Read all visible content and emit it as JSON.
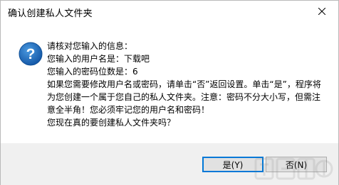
{
  "dialog": {
    "title": "确认创建私人文件夹",
    "close_icon": "close-icon",
    "icon": "question-icon",
    "accent_color": "#1f6fb2"
  },
  "message": {
    "lines": [
      "请核对您输入的信息：",
      "您输入的用户名是：下载吧",
      "您输入的密码位数是：6",
      "如果您需要修改用户名或密码，请单击“否”返回设置。单击“是”，程序将为您创建一个属于您自己的私人文件夹。注意：密码不分大小写，但需注意全半角！您必须牢记您的用户名和密码！",
      "您现在真的要创建私人文件夹吗？"
    ]
  },
  "buttons": {
    "yes": "是(Y)",
    "no": "否(N)"
  }
}
